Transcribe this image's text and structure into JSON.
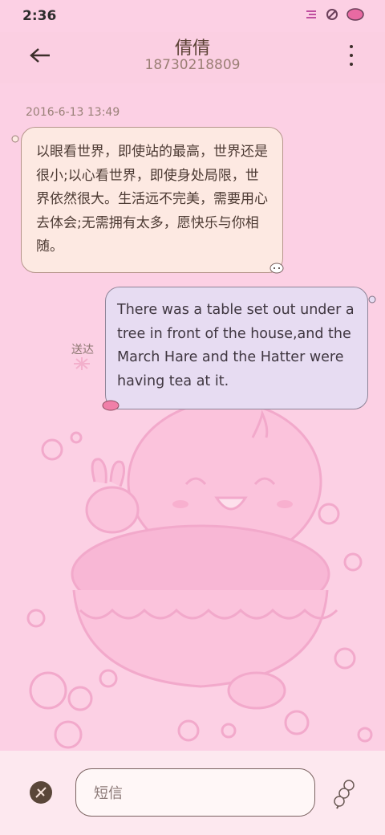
{
  "status_bar": {
    "time": "2:36"
  },
  "header": {
    "contact_name": "倩倩",
    "contact_number": "18730218809"
  },
  "conversation": {
    "timestamp": "2016-6-13 13:49",
    "messages": [
      {
        "direction": "incoming",
        "text": "以眼看世界，即使站的最高，世界还是很小;以心看世界，即使身处局限，世界依然很大。生活远不完美，需要用心去体会;无需拥有太多，愿快乐与你相随。"
      },
      {
        "direction": "outgoing",
        "text": "There was a table set out under a tree in front of the house,and the March Hare and the Hatter were having tea at it.",
        "status": "送达"
      }
    ]
  },
  "composer": {
    "placeholder": "短信"
  },
  "icons": {
    "back": "arrow-left-icon",
    "more": "more-vert-icon",
    "attach": "attach-icon",
    "send": "dango-send-icon"
  },
  "colors": {
    "background": "#fcd0e4",
    "incoming_bubble": "#fde9e2",
    "outgoing_bubble": "#e7dcf2",
    "text": "#4c3a33"
  }
}
